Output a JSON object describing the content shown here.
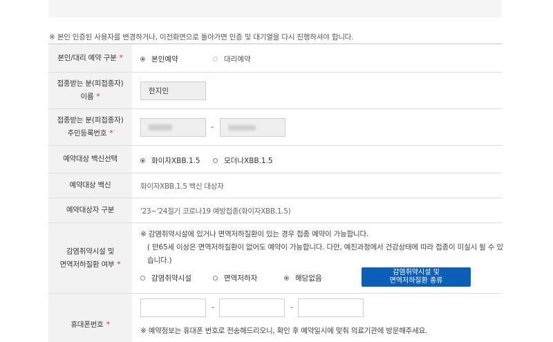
{
  "notice": "※ 본인 인증된 사용자를 변경하거나, 이전화면으로 돌아가면 인증 및 대기열을 다시 진행하셔야 합니다.",
  "rows": {
    "booking_type": {
      "label": "본인/대리 예약 구분",
      "options": [
        "본인예약",
        "대리예약"
      ]
    },
    "name": {
      "label_line1": "접종받는 분(피접종자)",
      "label_line2": "이름",
      "value": "한지민"
    },
    "rrn": {
      "label_line1": "접종받는 분(피접종자)",
      "label_line2": "주민등록번호",
      "separator": "-"
    },
    "vaccine_select": {
      "label": "예약대상 백신선택",
      "options": [
        "화이자XBB.1.5",
        "모더나XBB.1.5"
      ]
    },
    "vaccine": {
      "label": "예약대상 백신",
      "value": "화이자XBB.1.5 백신 대상자"
    },
    "target_type": {
      "label": "예약대상자 구분",
      "value": "'23~'24절기 코로나19 예방접종(화이자XBB.1.5)"
    },
    "vulnerable": {
      "label_line1": "감염취약시설 및",
      "label_line2": "면역저하질환 여부",
      "note_line1": "※ 감염취약시설에 있거나 면역저하질환이 있는 경우 접종 예약이 가능합니다.",
      "note_line2": "( 만65세 이상은 면역저하질환이 없어도 예약이 가능합니다. 다만, 예진과정에서 건강상태에 따라 접종이 미실시 될 수 있",
      "note_line3": "습니다.)",
      "options": [
        "감염취약시설",
        "면역저하자",
        "해당없음"
      ],
      "button_line1": "감염취약시설 및",
      "button_line2": "면역저하질환 종류"
    },
    "phone": {
      "label": "휴대폰번호",
      "separator": "-",
      "note": "※ 예약정보는 휴대폰 번호로 전송해드리오니, 확인 후 예약일시에 맞춰 의료기관에 방문해주세요."
    }
  },
  "required_mark": "*",
  "selected": {
    "booking_type": "본인예약",
    "vaccine_select": "화이자XBB.1.5",
    "vulnerable": "해당없음"
  }
}
